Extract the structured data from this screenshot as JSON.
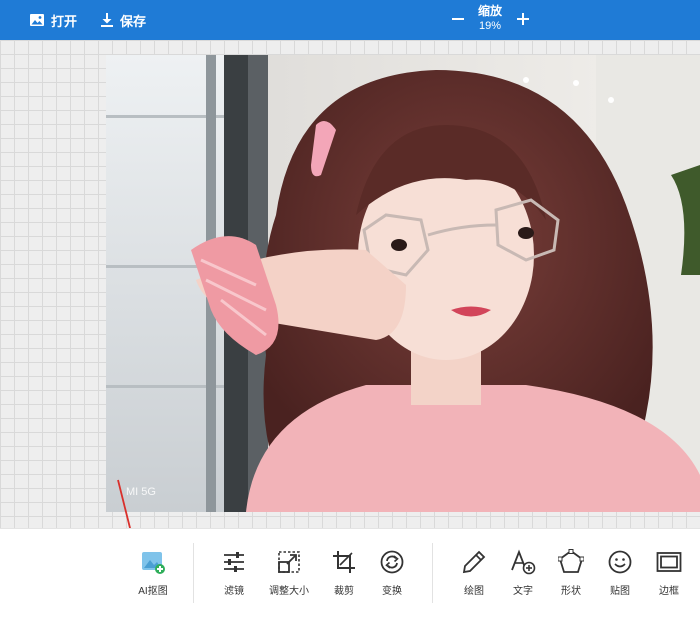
{
  "header": {
    "open_label": "打开",
    "save_label": "保存",
    "zoom_title": "缩放",
    "zoom_value": "19%"
  },
  "photo": {
    "overlay_text": "MI 5G"
  },
  "toolbar": {
    "ai_cutout": "AI抠图",
    "filter": "滤镜",
    "resize": "调整大小",
    "crop": "裁剪",
    "transform": "变换",
    "draw": "绘图",
    "text": "文字",
    "shape": "形状",
    "sticker": "贴图",
    "border": "边框"
  },
  "colors": {
    "accent": "#1f7bd6",
    "arrow": "#d9302c"
  }
}
